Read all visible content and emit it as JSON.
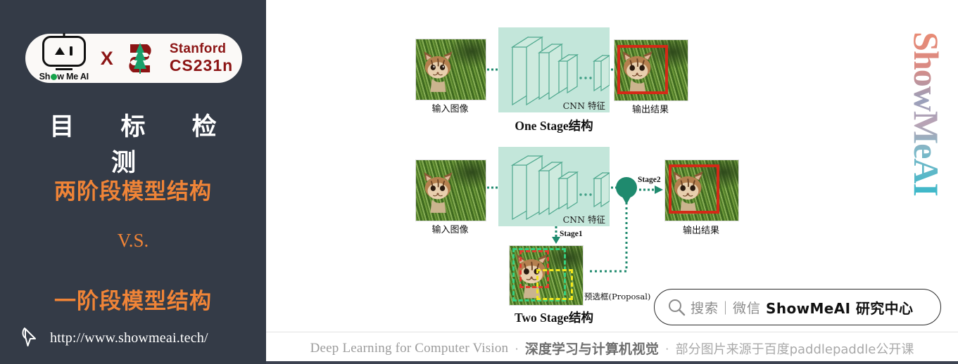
{
  "sidebar": {
    "badge": {
      "brand_logo_text": "Show Me AI",
      "cross_label": "X",
      "partner_line1": "Stanford",
      "partner_line2": "CS231n",
      "logo_icon": "showmeai-robot-icon",
      "partner_icon": "stanford-tree-icon"
    },
    "title": "目 标 检 测",
    "subtitle_1": "两阶段模型结构",
    "subtitle_2": "V.S.",
    "subtitle_3": "一阶段模型结构",
    "url": "http://www.showmeai.tech/",
    "cursor_icon": "cursor-pointer-icon",
    "colors": {
      "background": "#343b47",
      "accent": "#F08437",
      "badge_bg": "#fbf9f7",
      "partner_red": "#8C1515"
    }
  },
  "slide": {
    "vertical_logo": "ShowMeAI",
    "diagrams": [
      {
        "id": "one-stage",
        "title": "One Stage结构",
        "input_caption": "输入图像",
        "cnn_caption": "CNN 特征",
        "output_caption": "输出结果"
      },
      {
        "id": "two-stage",
        "title": "Two Stage结构",
        "input_caption": "输入图像",
        "cnn_caption": "CNN 特征",
        "output_caption": "输出结果",
        "stage1_label": "Stage1",
        "stage2_label": "Stage2",
        "proposal_caption": "预选框(Proposal)"
      }
    ],
    "colors": {
      "cnn_box": "#c3e6da",
      "cnn_outline": "#3f9e85",
      "node": "#1f8a6e",
      "detection_box": "#d42a17",
      "proposal_green": "#35d07f",
      "proposal_red": "#e23b2e",
      "proposal_yellow": "#f2e61c"
    }
  },
  "search": {
    "icon": "search-icon",
    "placeholder": "搜索｜微信",
    "account": "ShowMeAI 研究中心"
  },
  "footer": {
    "course_title": "Deep Learning for Computer Vision",
    "separator": "·",
    "course_title_cn": "深度学习与计算机视觉",
    "credit": "部分图片来源于百度paddlepaddle公开课"
  }
}
